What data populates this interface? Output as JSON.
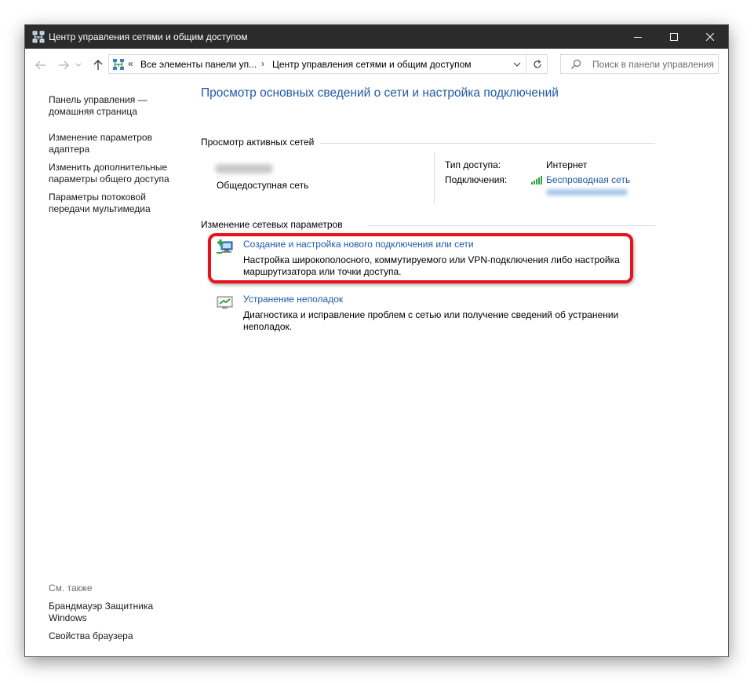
{
  "window": {
    "title": "Центр управления сетями и общим доступом"
  },
  "address": {
    "prefix": "«",
    "crumb1": "Все элементы панели уп...",
    "separator": "›",
    "crumb2": "Центр управления сетями и общим доступом"
  },
  "search": {
    "placeholder": "Поиск в панели управления"
  },
  "sidebar": {
    "home": "Панель управления — домашняя страница",
    "items": [
      "Изменение параметров адаптера",
      "Изменить дополнительные параметры общего доступа",
      "Параметры потоковой передачи мультимедиа"
    ],
    "see_also_heading": "См. также",
    "see_also": [
      "Брандмауэр Защитника Windows",
      "Свойства браузера"
    ]
  },
  "main": {
    "title": "Просмотр основных сведений о сети и настройка подключений",
    "active_networks_heading": "Просмотр активных сетей",
    "network_type": "Общедоступная сеть",
    "access_type_label": "Тип доступа:",
    "access_type_value": "Интернет",
    "connections_label": "Подключения:",
    "connections_value": "Беспроводная сеть",
    "change_settings_heading": "Изменение сетевых параметров",
    "tasks": [
      {
        "link": "Создание и настройка нового подключения или сети",
        "description": "Настройка широкополосного, коммутируемого или VPN-подключения либо настройка маршрутизатора или точки доступа."
      },
      {
        "link": "Устранение неполадок",
        "description": "Диагностика и исправление проблем с сетью или получение сведений об устранении неполадок."
      }
    ]
  },
  "colors": {
    "titlebar": "#2b2b2b",
    "link": "#1e5aa8",
    "highlight": "#e3141b"
  }
}
